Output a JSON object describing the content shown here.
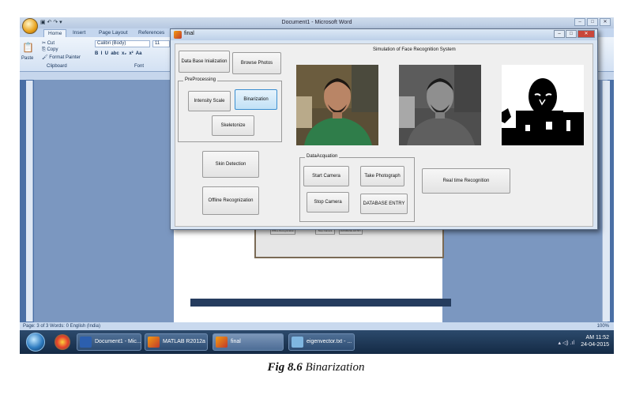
{
  "word": {
    "title": "Document1 - Microsoft Word",
    "tabs": [
      "Home",
      "Insert",
      "Page Layout",
      "References"
    ],
    "clipboard": {
      "cut": "Cut",
      "copy": "Copy",
      "paste": "Paste",
      "format_painter": "Format Painter",
      "group": "Clipboard"
    },
    "font": {
      "name": "Calibri (Body)",
      "size": "11",
      "group": "Font"
    },
    "status": "Page: 3 of 3   Words: 0   English (India)",
    "zoom": "100%"
  },
  "taskbar": {
    "items": [
      "Document1 - Mic...",
      "MATLAB R2012a",
      "final",
      "eigenvector.txt - ..."
    ],
    "time": "AM 11:52",
    "date": "24-04-2015"
  },
  "figure": {
    "window_title": "final",
    "heading": "Simulation of Face Recognition System",
    "buttons": {
      "db_init": "Data Base Inialization",
      "browse": "Browse Photos",
      "skin": "Skin Detection",
      "offline": "Offline Recognization",
      "realtime": "Real time Recognition"
    },
    "preprocessing": {
      "title": "PreProcessing",
      "intensity": "Intensity Scale",
      "binarization": "Binarization",
      "skeletonize": "Skeletonize"
    },
    "acquisition": {
      "title": "DataAcquation",
      "start": "Start Camera",
      "photo": "Take Photograph",
      "stop": "Stop Camera",
      "entry": "DATABASE ENTRY"
    },
    "images": [
      "color-face-photo",
      "grayscale-face-photo",
      "binarized-face-photo"
    ]
  },
  "caption": {
    "label": "Fig 8.6",
    "text": " Binarization"
  }
}
